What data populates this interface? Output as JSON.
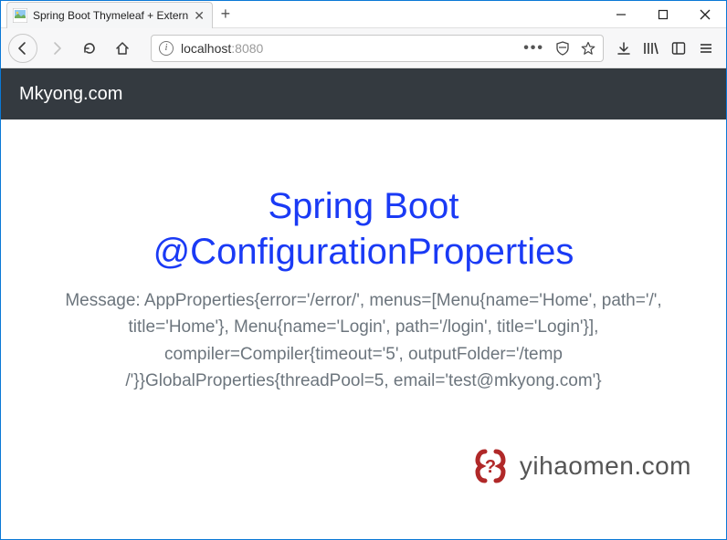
{
  "tab": {
    "title": "Spring Boot Thymeleaf + Extern"
  },
  "url": {
    "host": "localhost",
    "port": ":8080"
  },
  "site": {
    "brand": "Mkyong.com"
  },
  "content": {
    "title_line1": "Spring Boot",
    "title_line2": "@ConfigurationProperties",
    "message": "Message: AppProperties{error='/error/', menus=[Menu{name='Home', path='/', title='Home'}, Menu{name='Login', path='/login', title='Login'}], compiler=Compiler{timeout='5', outputFolder='/temp /'}}GlobalProperties{threadPool=5, email='test@mkyong.com'}"
  },
  "watermark": {
    "text": "yihaomen.com"
  }
}
